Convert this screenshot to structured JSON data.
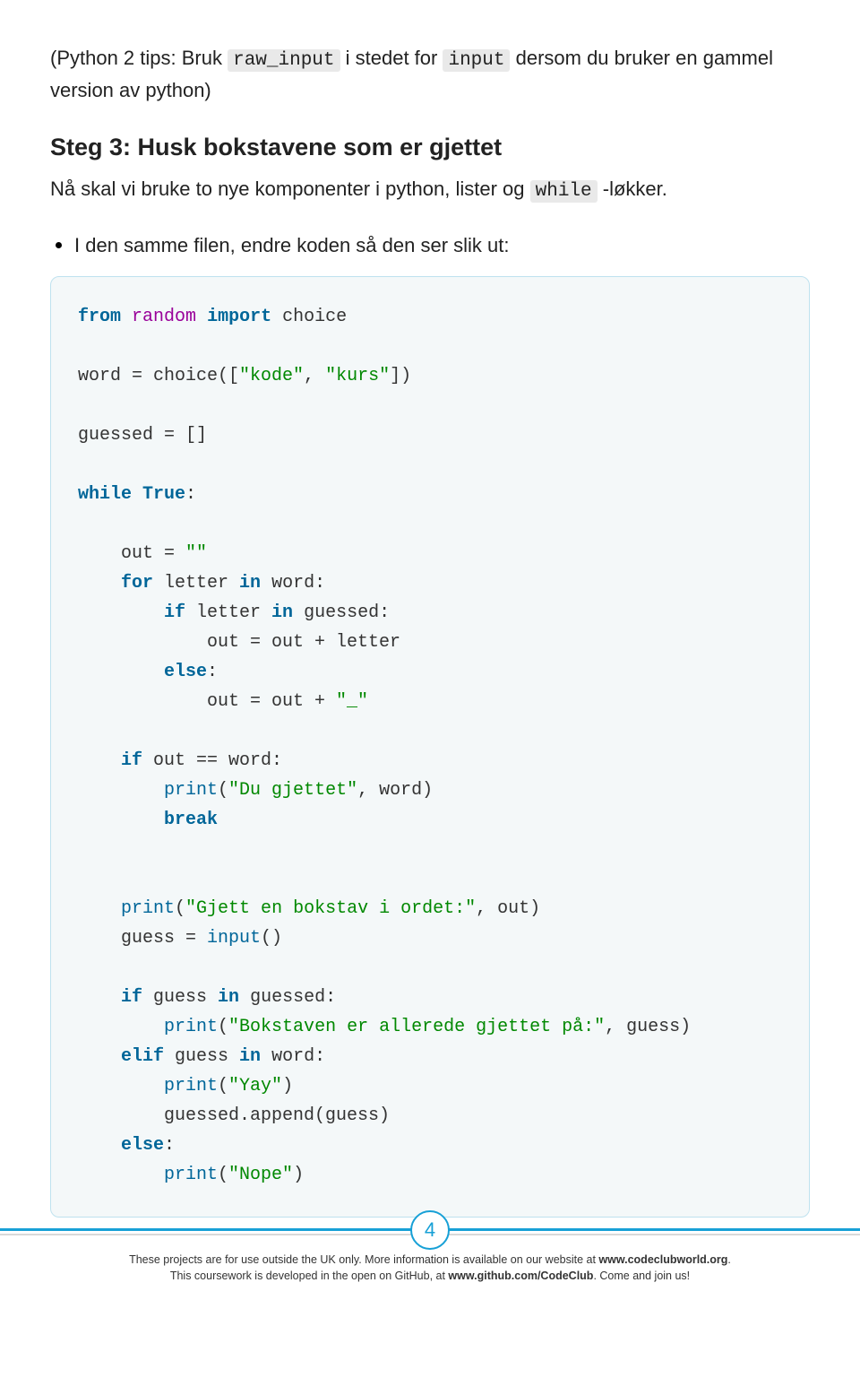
{
  "tip": {
    "pre": "(Python 2 tips: Bruk ",
    "chip1": "raw_input",
    "mid1": " i stedet for ",
    "chip2": "input",
    "post": " dersom du bruker en gammel version av python)"
  },
  "heading": "Steg 3: Husk bokstavene som er gjettet",
  "intro": {
    "pre": "Nå skal vi bruke to nye komponenter i python, lister og ",
    "chip": "while",
    "post": " -løkker."
  },
  "bullet": "I den samme filen, endre koden så den ser slik ut:",
  "code": {
    "l01_from": "from",
    "l01_pkg": "random",
    "l01_import": "import",
    "l01_choice": "choice",
    "l03_word": "word = choice([",
    "l03_s1": "\"kode\"",
    "l03_c": ", ",
    "l03_s2": "\"kurs\"",
    "l03_end": "])",
    "l05_guessed": "guessed = []",
    "l07_while": "while",
    "l07_true": "True",
    "l07_colon": ":",
    "l09_out": "    out = ",
    "l09_str": "\"\"",
    "l10_for": "for",
    "l10_rest": " letter ",
    "l10_in": "in",
    "l10_word": " word:",
    "l11_if": "if",
    "l11_rest": " letter ",
    "l11_in": "in",
    "l11_g": " guessed:",
    "l12": "            out = out + letter",
    "l13_else": "else",
    "l13_colon": ":",
    "l14_pre": "            out = out + ",
    "l14_str": "\"_\"",
    "l16_if": "if",
    "l16_rest": " out == word:",
    "l17_print": "print",
    "l17_open": "(",
    "l17_str": "\"Du gjettet\"",
    "l17_rest": ", word)",
    "l18_break": "break",
    "l21_print": "print",
    "l21_open": "(",
    "l21_str": "\"Gjett en bokstav i ordet:\"",
    "l21_rest": ", out)",
    "l22_pre": "    guess = ",
    "l22_input": "input",
    "l22_post": "()",
    "l24_if": "if",
    "l24_rest": " guess ",
    "l24_in": "in",
    "l24_g": " guessed:",
    "l25_print": "print",
    "l25_open": "(",
    "l25_str": "\"Bokstaven er allerede gjettet på:\"",
    "l25_rest": ", guess)",
    "l26_elif": "elif",
    "l26_rest": " guess ",
    "l26_in": "in",
    "l26_w": " word:",
    "l27_print": "print",
    "l27_open": "(",
    "l27_str": "\"Yay\"",
    "l27_close": ")",
    "l28": "        guessed.append(guess)",
    "l29_else": "else",
    "l29_colon": ":",
    "l30_print": "print",
    "l30_open": "(",
    "l30_str": "\"Nope\"",
    "l30_close": ")"
  },
  "pagenum": "4",
  "footer": {
    "line1a": "These projects are for use outside the UK only. More information is available on our website at ",
    "line1b": "www.codeclubworld.org",
    "line1c": ".",
    "line2a": "This coursework is developed in the open on GitHub, at ",
    "line2b": "www.github.com/CodeClub",
    "line2c": ". Come and join us!"
  }
}
